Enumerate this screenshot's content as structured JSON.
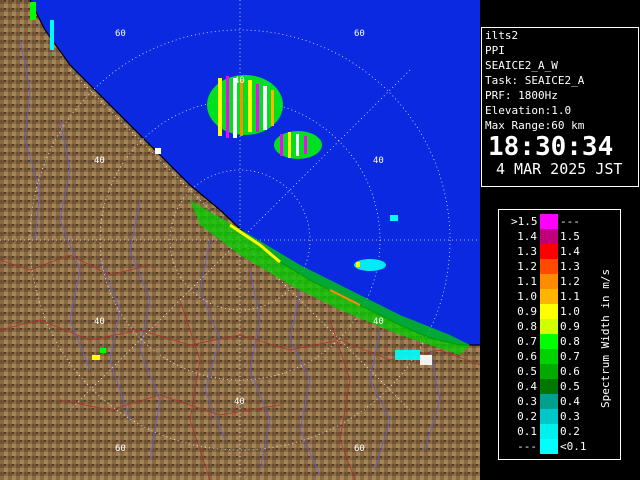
{
  "station": "ilts2",
  "scan_type": "PPI",
  "task_short": "SEAICE2_A_W",
  "task_line": "Task: SEAICE2_A",
  "prf_line": "PRF: 1800Hz",
  "elevation_line": "Elevation:1.0",
  "range_line": "Max Range:60 km",
  "time": "18:30:34",
  "date": "4 MAR 2025 JST",
  "range_labels": {
    "r40": "40",
    "r60": "60"
  },
  "legend": {
    "title": "Spectrum Width in m/s",
    "rows": [
      {
        "lo": ">1.5",
        "hi": "---",
        "color": "#ff00ff"
      },
      {
        "lo": "1.4",
        "hi": "1.5",
        "color": "#c0007a"
      },
      {
        "lo": "1.3",
        "hi": "1.4",
        "color": "#ff0000"
      },
      {
        "lo": "1.2",
        "hi": "1.3",
        "color": "#ff4a00"
      },
      {
        "lo": "1.1",
        "hi": "1.2",
        "color": "#ff8c00"
      },
      {
        "lo": "1.0",
        "hi": "1.1",
        "color": "#ffb400"
      },
      {
        "lo": "0.9",
        "hi": "1.0",
        "color": "#ffff00"
      },
      {
        "lo": "0.8",
        "hi": "0.9",
        "color": "#d2ff00"
      },
      {
        "lo": "0.7",
        "hi": "0.8",
        "color": "#00ff00"
      },
      {
        "lo": "0.6",
        "hi": "0.7",
        "color": "#00d200"
      },
      {
        "lo": "0.5",
        "hi": "0.6",
        "color": "#00aa00"
      },
      {
        "lo": "0.4",
        "hi": "0.5",
        "color": "#007800"
      },
      {
        "lo": "0.3",
        "hi": "0.4",
        "color": "#00a08c"
      },
      {
        "lo": "0.2",
        "hi": "0.3",
        "color": "#00c8c8"
      },
      {
        "lo": "0.1",
        "hi": "0.2",
        "color": "#00f0f0"
      },
      {
        "lo": "---",
        "hi": "<0.1",
        "color": "#00ffff"
      }
    ]
  },
  "colors": {
    "sea": "#0a29e0",
    "land": "#8a6a42",
    "rings": "#ffffff",
    "rivers": "#6060d0",
    "borders": "#b03030"
  }
}
